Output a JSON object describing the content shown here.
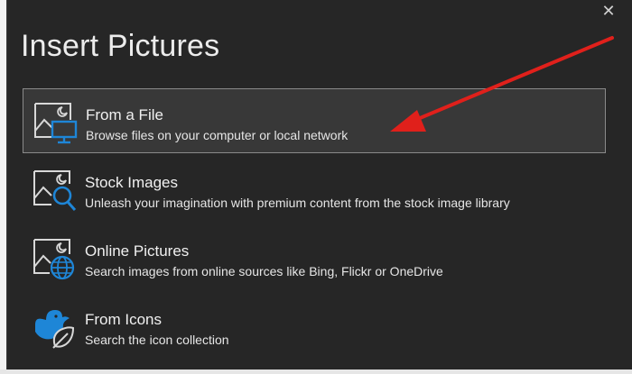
{
  "dialog": {
    "title": "Insert Pictures",
    "close_glyph": "✕"
  },
  "options": [
    {
      "label": "From a File",
      "description": "Browse files on your computer or local network",
      "icon": "picture-monitor-icon",
      "selected": true
    },
    {
      "label": "Stock Images",
      "description": "Unleash your imagination with premium content from the stock image library",
      "icon": "picture-search-icon",
      "selected": false
    },
    {
      "label": "Online Pictures",
      "description": "Search images from online sources like Bing, Flickr or OneDrive",
      "icon": "picture-globe-icon",
      "selected": false
    },
    {
      "label": "From Icons",
      "description": "Search the icon collection",
      "icon": "bird-leaf-icon",
      "selected": false
    }
  ],
  "colors": {
    "background": "#262626",
    "accent": "#1e86d7",
    "annotation_arrow": "#e0201b"
  }
}
